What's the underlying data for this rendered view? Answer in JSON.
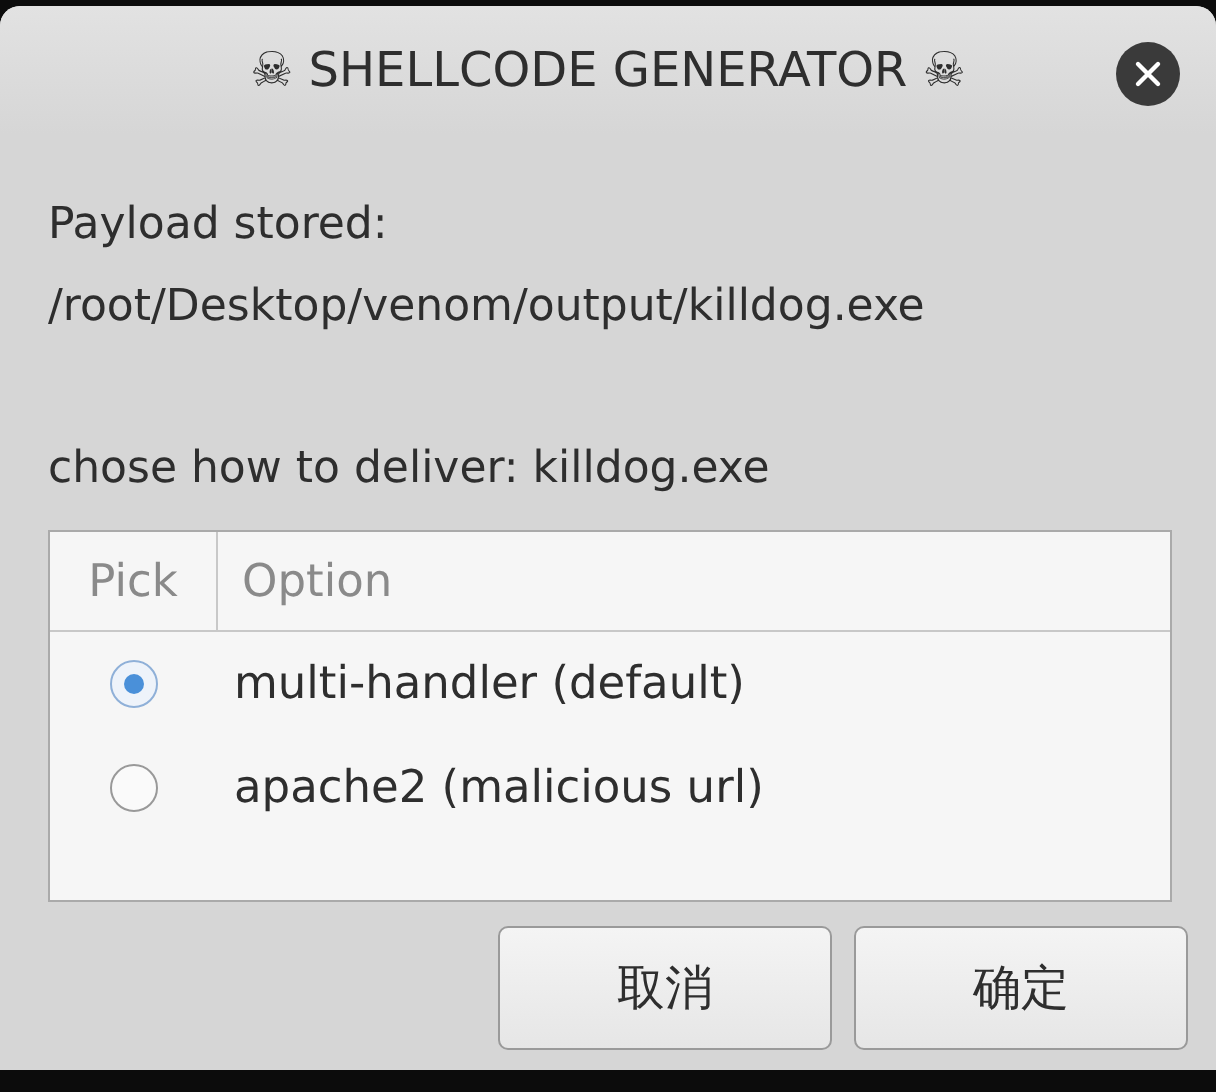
{
  "window": {
    "title": "☠ SHELLCODE GENERATOR ☠"
  },
  "message": [
    [
      "Payload stored:",
      "/root/Desktop/venom/output/killdog.exe"
    ],
    [
      "chose how to deliver: killdog.exe"
    ]
  ],
  "table": {
    "columns": [
      "Pick",
      "Option"
    ],
    "rows": [
      {
        "option": "multi-handler (default)",
        "selected": true
      },
      {
        "option": "apache2 (malicious url)",
        "selected": false
      }
    ]
  },
  "buttons": [
    "取消",
    "确定"
  ]
}
